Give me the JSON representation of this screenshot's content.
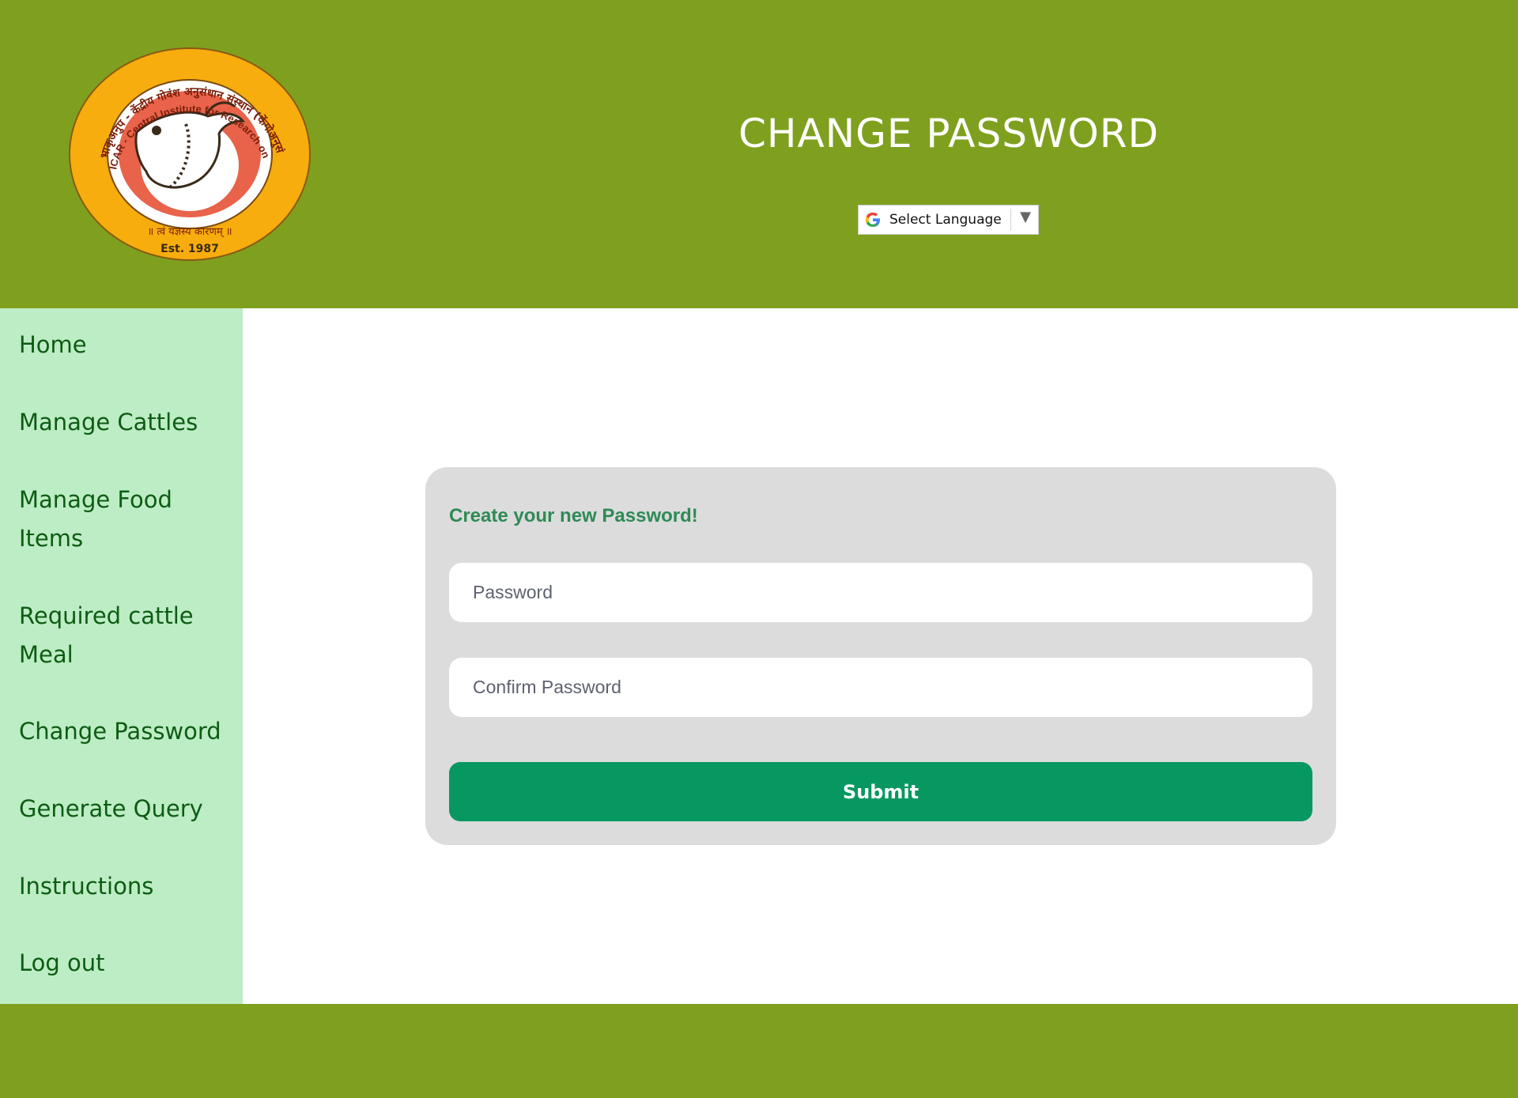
{
  "header": {
    "title": "CHANGE PASSWORD",
    "language_selector": {
      "label": "Select Language",
      "icon": "google-icon",
      "arrow": "▼"
    },
    "logo": {
      "top_text": "भाकृअनुप - केंद्रीय गोवंश अनुसंधान संस्थान (केंगोअनुसं)",
      "ring_text": "ICAR - Central Institute for Research on Cattle (CIRC)",
      "motto": "॥ त्वं यज्ञस्य कारणम् ॥",
      "established": "Est. 1987"
    }
  },
  "sidebar": {
    "items": [
      {
        "label": "Home"
      },
      {
        "label": "Manage Cattles"
      },
      {
        "label": "Manage Food Items"
      },
      {
        "label": "Required cattle Meal"
      },
      {
        "label": "Change Password"
      },
      {
        "label": "Generate Query"
      },
      {
        "label": "Instructions"
      },
      {
        "label": "Log out"
      }
    ]
  },
  "form": {
    "heading": "Create your new Password!",
    "password_placeholder": "Password",
    "password_value": "",
    "confirm_placeholder": "Confirm Password",
    "confirm_value": "",
    "submit_label": "Submit"
  },
  "colors": {
    "header_bg": "#7fa01e",
    "sidebar_bg": "#bdedc4",
    "nav_text": "#0d5c14",
    "card_bg": "#dcdcdc",
    "heading_text": "#2e8a55",
    "submit_bg": "#079862"
  }
}
